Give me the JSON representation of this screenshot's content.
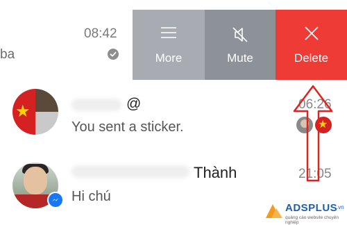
{
  "conversations": [
    {
      "snippet_partial": "ba",
      "time": "08:42",
      "status_icon": "read-check-icon",
      "swipe_actions": [
        {
          "label": "More",
          "icon": "hamburger-menu-icon",
          "color": "#a8acb2"
        },
        {
          "label": "Mute",
          "icon": "muted-speaker-icon",
          "color": "#8d9198"
        },
        {
          "label": "Delete",
          "icon": "close-x-icon",
          "color": "#ef3b36"
        }
      ]
    },
    {
      "name_visible": "@",
      "snippet": "You sent a sticker.",
      "time": "06:26",
      "avatar": "group-avatar-collage",
      "seen_by": [
        "participant-avatar",
        "flag-avatar"
      ]
    },
    {
      "name_visible": "Thành",
      "snippet": "Hi chú",
      "time": "21:05",
      "avatar": "person-avatar",
      "badge": "messenger-icon"
    }
  ],
  "watermark": {
    "brand": "ADSPLUS",
    "tld": ".vn",
    "tagline": "quảng cáo website chuyên nghiệp"
  },
  "colors": {
    "more": "#a8acb2",
    "mute": "#8d9198",
    "delete": "#ef3b36",
    "tutorial_arrow": "#e0211d"
  }
}
